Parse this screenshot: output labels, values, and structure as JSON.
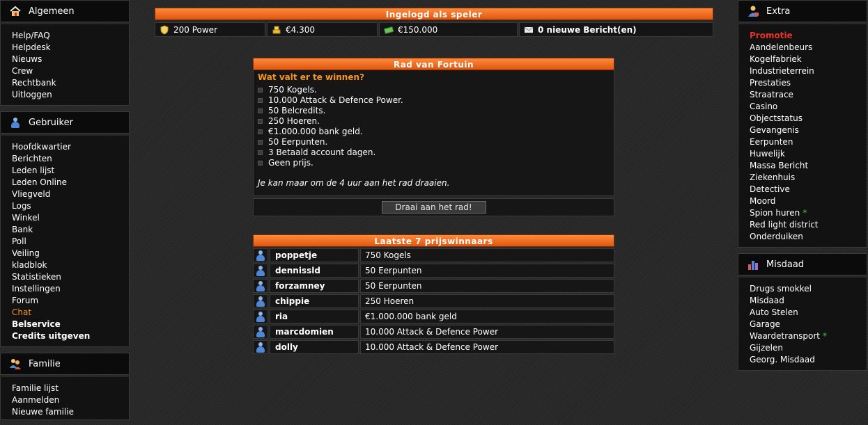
{
  "left_menu": {
    "sections": [
      {
        "title": "Algemeen",
        "icon": "home-icon",
        "items": [
          "Help/FAQ",
          "Helpdesk",
          "Nieuws",
          "Crew",
          "Rechtbank",
          "Uitloggen"
        ]
      },
      {
        "title": "Gebruiker",
        "icon": "user-icon",
        "items": [
          "Hoofdkwartier",
          "Berichten",
          "Leden lijst",
          "Leden Online",
          "Vliegveld",
          "Logs",
          "Winkel",
          "Bank",
          "Poll",
          "Veiling",
          "kladblok",
          "Statistieken",
          "Instellingen",
          "Forum",
          "Chat",
          "Belservice",
          "Credits uitgeven"
        ]
      },
      {
        "title": "Familie",
        "icon": "family-icon",
        "items": [
          "Familie lijst",
          "Aanmelden",
          "Nieuwe familie"
        ]
      }
    ]
  },
  "right_menu": {
    "sections": [
      {
        "title": "Extra",
        "icon": "user-extra-icon",
        "items": [
          "Promotie",
          "Aandelenbeurs",
          "Kogelfabriek",
          "Industrieterrein",
          "Prestaties",
          "Straatrace",
          "Casino",
          "Objectstatus",
          "Gevangenis",
          "Eerpunten",
          "Huwelijk",
          "Massa Bericht",
          "Ziekenhuis",
          "Detective",
          "Moord",
          "Spion huren",
          "Red light district",
          "Onderduiken"
        ]
      },
      {
        "title": "Misdaad",
        "icon": "chart-icon",
        "items": [
          "Drugs smokkel",
          "Misdaad",
          "Auto Stelen",
          "Garage",
          "Waardetransport",
          "Gijzelen",
          "Georg. Misdaad"
        ]
      }
    ],
    "star_symbol": "*"
  },
  "status": {
    "title": "Ingelogd als speler",
    "power": "200 Power",
    "cash": "€4.300",
    "bank": "€150.000",
    "messages": "0 nieuwe Bericht(en)"
  },
  "wheel": {
    "title": "Rad van Fortuin",
    "prizes_title": "Wat valt er te winnen?",
    "prizes": [
      "750 Kogels.",
      "10.000 Attack & Defence Power.",
      "50 Belcredits.",
      "250 Hoeren.",
      "€1.000.000 bank geld.",
      "50 Eerpunten.",
      "3 Betaald account dagen.",
      "Geen prijs."
    ],
    "note": "Je kan maar om de 4 uur aan het rad draaien.",
    "spin_button": "Draai aan het rad!"
  },
  "winners": {
    "title": "Laatste 7 prijswinnaars",
    "rows": [
      {
        "name": "poppetje",
        "prize": "750 Kogels"
      },
      {
        "name": "dennissld",
        "prize": "50 Eerpunten"
      },
      {
        "name": "forzamney",
        "prize": "50 Eerpunten"
      },
      {
        "name": "chippie",
        "prize": "250 Hoeren"
      },
      {
        "name": "ria",
        "prize": "€1.000.000 bank geld"
      },
      {
        "name": "marcdomien",
        "prize": "10.000 Attack & Defence Power"
      },
      {
        "name": "dolly",
        "prize": "10.000 Attack & Defence Power"
      }
    ]
  },
  "colors": {
    "accent_orange": "#f7931e",
    "header_orange": "#e86a1e",
    "promo_red": "#e8322a",
    "star_green": "#3fd13f"
  }
}
